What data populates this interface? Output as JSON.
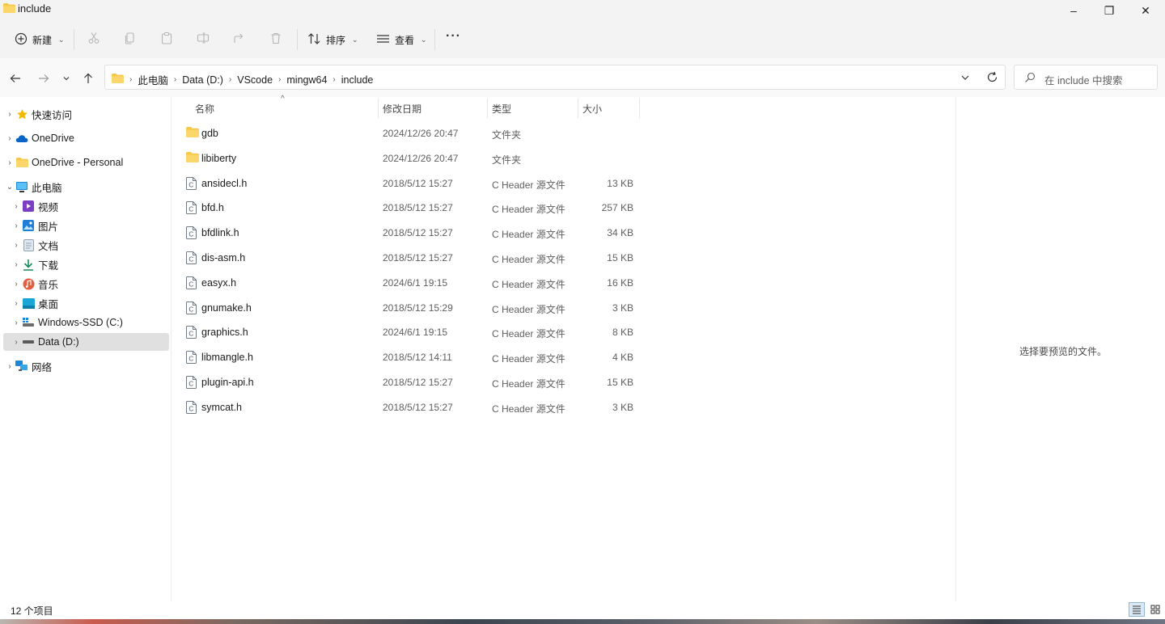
{
  "window": {
    "title": "include",
    "controls": {
      "minimize": "–",
      "maximize": "❐",
      "close": "✕"
    }
  },
  "toolbar": {
    "new_label": "新建",
    "sort_label": "排序",
    "view_label": "查看",
    "more_label": "···"
  },
  "address": {
    "crumbs": [
      "此电脑",
      "Data (D:)",
      "VScode",
      "mingw64",
      "include"
    ],
    "search_placeholder": "在 include 中搜索"
  },
  "nav": {
    "items": [
      {
        "label": "快速访问",
        "icon": "star-icon"
      },
      {
        "label": "OneDrive",
        "icon": "cloud-icon"
      },
      {
        "label": "OneDrive - Personal",
        "icon": "folder-icon"
      },
      {
        "label": "此电脑",
        "icon": "computer-icon"
      },
      {
        "label": "视频",
        "icon": "video-icon"
      },
      {
        "label": "图片",
        "icon": "picture-icon"
      },
      {
        "label": "文档",
        "icon": "document-icon"
      },
      {
        "label": "下载",
        "icon": "download-icon"
      },
      {
        "label": "音乐",
        "icon": "music-icon"
      },
      {
        "label": "桌面",
        "icon": "desktop-icon"
      },
      {
        "label": "Windows-SSD (C:)",
        "icon": "drive-icon"
      },
      {
        "label": "Data (D:)",
        "icon": "drive-icon"
      },
      {
        "label": "网络",
        "icon": "network-icon"
      }
    ],
    "selected": "Data (D:)"
  },
  "list": {
    "columns": {
      "name": "名称",
      "date": "修改日期",
      "type": "类型",
      "size": "大小"
    },
    "sort_indicator": "^",
    "rows": [
      {
        "name": "gdb",
        "date": "2024/12/26 20:47",
        "type": "文件夹",
        "size": "",
        "kind": "folder"
      },
      {
        "name": "libiberty",
        "date": "2024/12/26 20:47",
        "type": "文件夹",
        "size": "",
        "kind": "folder"
      },
      {
        "name": "ansidecl.h",
        "date": "2018/5/12 15:27",
        "type": "C Header 源文件",
        "size": "13 KB",
        "kind": "file"
      },
      {
        "name": "bfd.h",
        "date": "2018/5/12 15:27",
        "type": "C Header 源文件",
        "size": "257 KB",
        "kind": "file"
      },
      {
        "name": "bfdlink.h",
        "date": "2018/5/12 15:27",
        "type": "C Header 源文件",
        "size": "34 KB",
        "kind": "file"
      },
      {
        "name": "dis-asm.h",
        "date": "2018/5/12 15:27",
        "type": "C Header 源文件",
        "size": "15 KB",
        "kind": "file"
      },
      {
        "name": "easyx.h",
        "date": "2024/6/1 19:15",
        "type": "C Header 源文件",
        "size": "16 KB",
        "kind": "file"
      },
      {
        "name": "gnumake.h",
        "date": "2018/5/12 15:29",
        "type": "C Header 源文件",
        "size": "3 KB",
        "kind": "file"
      },
      {
        "name": "graphics.h",
        "date": "2024/6/1 19:15",
        "type": "C Header 源文件",
        "size": "8 KB",
        "kind": "file"
      },
      {
        "name": "libmangle.h",
        "date": "2018/5/12 14:11",
        "type": "C Header 源文件",
        "size": "4 KB",
        "kind": "file"
      },
      {
        "name": "plugin-api.h",
        "date": "2018/5/12 15:27",
        "type": "C Header 源文件",
        "size": "15 KB",
        "kind": "file"
      },
      {
        "name": "symcat.h",
        "date": "2018/5/12 15:27",
        "type": "C Header 源文件",
        "size": "3 KB",
        "kind": "file"
      }
    ]
  },
  "preview": {
    "message": "选择要预览的文件。"
  },
  "status": {
    "item_count": "12 个项目"
  },
  "colors": {
    "folder": "#f6c84a",
    "accent": "#0a64c8",
    "selected": "#e0e0e0"
  }
}
